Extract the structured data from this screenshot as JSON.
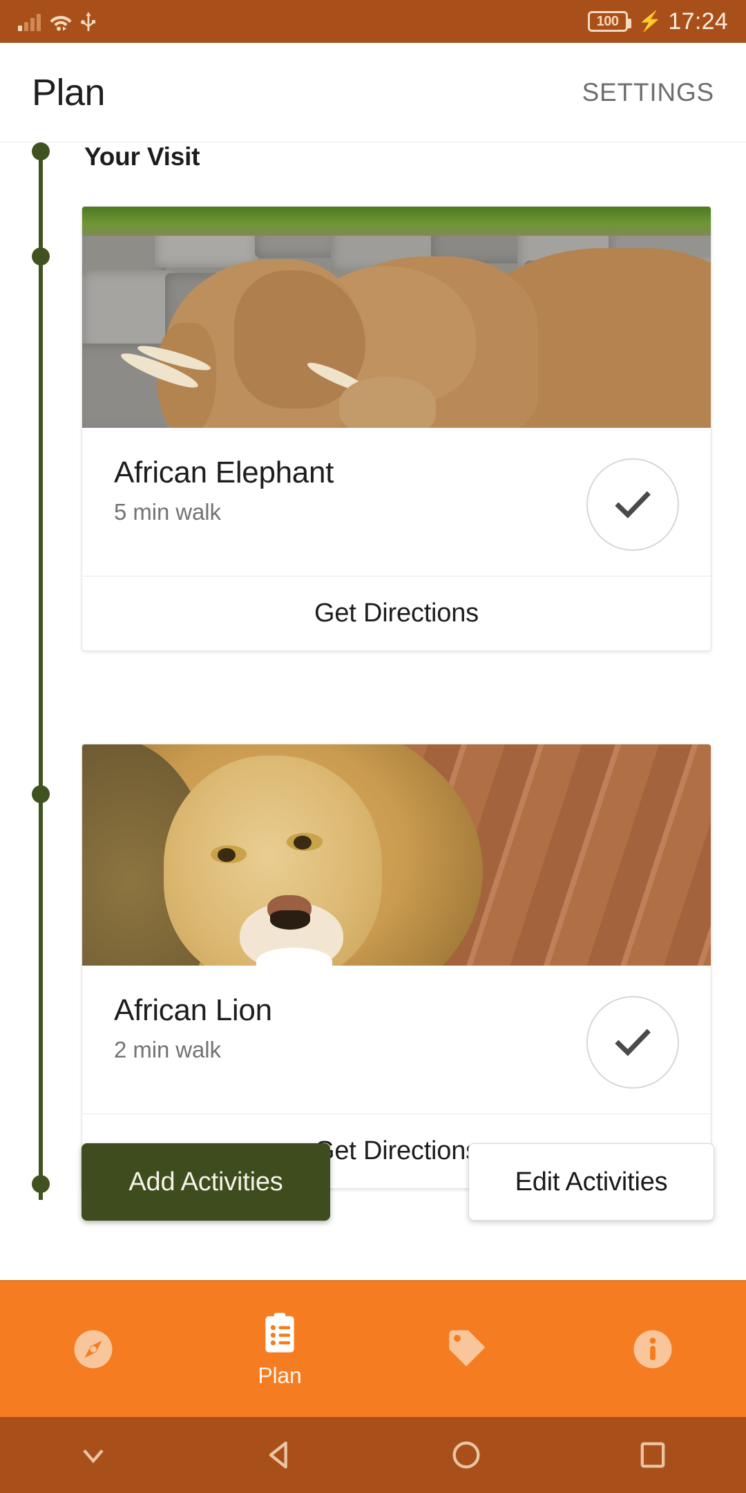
{
  "status_bar": {
    "signal_icon": "signal-bars-icon",
    "wifi_icon": "wifi-icon",
    "usb_icon": "usb-icon",
    "battery_level": "100",
    "charging_icon": "charging-bolt-icon",
    "time": "17:24",
    "background_color": "#A9501A"
  },
  "header": {
    "title": "Plan",
    "settings_label": "SETTINGS"
  },
  "content": {
    "section_title": "Your Visit",
    "timeline_color": "#40521F",
    "cards": [
      {
        "photo": "african-elephant-photo",
        "title": "African Elephant",
        "subtitle": "5 min walk",
        "check_icon": "check-icon",
        "action_label": "Get Directions"
      },
      {
        "photo": "african-lion-photo",
        "title": "African Lion",
        "subtitle": "2 min walk",
        "check_icon": "check-icon",
        "action_label": "Get Directions"
      }
    ],
    "buttons": {
      "add_label": "Add Activities",
      "add_color": "#3E4C1E",
      "edit_label": "Edit Activities"
    }
  },
  "bottom_nav": {
    "background_color": "#F57C20",
    "items": [
      {
        "icon": "compass-icon",
        "label": "",
        "active": false
      },
      {
        "icon": "clipboard-list-icon",
        "label": "Plan",
        "active": true
      },
      {
        "icon": "tag-icon",
        "label": "",
        "active": false
      },
      {
        "icon": "info-icon",
        "label": "",
        "active": false
      }
    ]
  },
  "android_nav": {
    "background_color": "#A9501A",
    "buttons": [
      {
        "icon": "chevron-down-icon"
      },
      {
        "icon": "back-triangle-icon"
      },
      {
        "icon": "home-circle-icon"
      },
      {
        "icon": "recents-square-icon"
      }
    ]
  }
}
